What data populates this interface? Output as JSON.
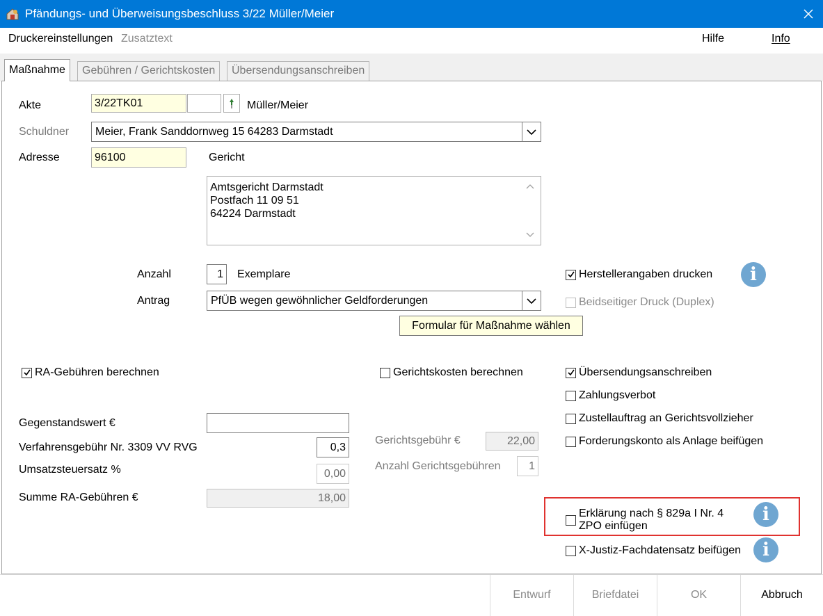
{
  "window": {
    "title": "Pfändungs- und Überweisungsbeschluss  3/22 Müller/Meier",
    "app_icon": "app-icon",
    "close_icon": "close-icon"
  },
  "menu": {
    "druckereinstellungen": "Druckereinstellungen",
    "zusatztext": "Zusatztext",
    "hilfe": "Hilfe",
    "info": "Info"
  },
  "tabs": [
    {
      "label": "Maßnahme",
      "active": true
    },
    {
      "label": "Gebühren / Gerichtskosten",
      "active": false
    },
    {
      "label": "Übersendungsanschreiben",
      "active": false
    }
  ],
  "form": {
    "akte_label": "Akte",
    "akte_value": "3/22TK01",
    "akte_extra_value": "",
    "akte_name": "Müller/Meier",
    "schuldner_label": "Schuldner",
    "schuldner_value": "Meier, Frank  Sanddornweg 15 64283 Darmstadt",
    "adresse_label": "Adresse",
    "adresse_value": "96100",
    "gericht_label": "Gericht",
    "gericht_lines": [
      "Amtsgericht Darmstadt",
      "Postfach 11 09 51",
      "64224 Darmstadt"
    ],
    "anzahl_label": "Anzahl",
    "anzahl_value": "1",
    "exemplare_label": "Exemplare",
    "antrag_label": "Antrag",
    "antrag_value": "PfÜB wegen gewöhnlicher Geldforderungen",
    "tooltip": "Formular für Maßnahme wählen"
  },
  "options": {
    "herstellerangaben": {
      "label": "Herstellerangaben drucken",
      "checked": true
    },
    "duplex": {
      "label": "Beidseitiger Druck (Duplex)",
      "checked": false,
      "disabled": true
    },
    "ra_gebuehren": {
      "label": "RA-Gebühren berechnen",
      "checked": true
    },
    "gerichtskosten": {
      "label": "Gerichtskosten berechnen",
      "checked": false
    },
    "uebersendung": {
      "label": "Übersendungsanschreiben",
      "checked": true
    },
    "zahlungsverbot": {
      "label": "Zahlungsverbot",
      "checked": false
    },
    "zustellauftrag": {
      "label": "Zustellauftrag an Gerichtsvollzieher",
      "checked": false
    },
    "forderungskonto": {
      "label": "Forderungskonto als Anlage beifügen",
      "checked": false
    },
    "erklaerung": {
      "label_line1": "Erklärung nach § 829a I Nr. 4",
      "label_line2": "ZPO einfügen",
      "checked": false
    },
    "xjustiz": {
      "label": "X-Justiz-Fachdatensatz beifügen",
      "checked": false
    }
  },
  "fees": {
    "gegenstandswert_label": "Gegenstandswert €",
    "gegenstandswert_value": "",
    "verfahrensgebuehr_label": "Verfahrensgebühr Nr. 3309 VV RVG",
    "verfahrensgebuehr_value": "0,3",
    "ust_label": "Umsatzsteuersatz %",
    "ust_value": "0,00",
    "summe_label": "Summe RA-Gebühren €",
    "summe_value": "18,00",
    "gerichtsgebuehr_label": "Gerichtsgebühr €",
    "gerichtsgebuehr_value": "22,00",
    "anzahl_gg_label": "Anzahl Gerichtsgebühren",
    "anzahl_gg_value": "1"
  },
  "buttons": {
    "entwurf": "Entwurf",
    "briefdatei": "Briefdatei",
    "ok": "OK",
    "abbruch": "Abbruch"
  },
  "colors": {
    "titlebar": "#0078d7",
    "highlight_box": "#e0322f",
    "info_icon": "#6fa6d1",
    "yellow_field": "#ffffe1"
  }
}
